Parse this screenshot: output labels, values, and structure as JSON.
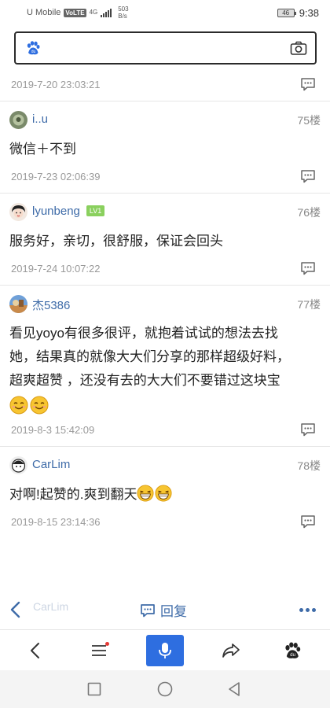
{
  "status_bar": {
    "carrier": "U Mobile",
    "volte": "VoLTE",
    "network": "4G",
    "speed_value": "503",
    "speed_unit": "B/s",
    "battery": "46",
    "time": "9:38"
  },
  "search": {
    "icons": [
      "baidu-paw-icon",
      "camera-icon"
    ]
  },
  "top_meta": {
    "timestamp": "2019-7-20 23:03:21"
  },
  "posts": [
    {
      "username": "i..u",
      "floor": "75楼",
      "content": "微信＋不到",
      "timestamp": "2019-7-23 02:06:39"
    },
    {
      "username": "lyunbeng",
      "level": "LV1",
      "floor": "76楼",
      "content": "服务好，亲切，很舒服，保证会回头",
      "timestamp": "2019-7-24 10:07:22"
    },
    {
      "username": "杰5386",
      "floor": "77楼",
      "content_lines": [
        "看见yoyo有很多很评，就抱着试试的想法去找",
        "她，结果真的就像大大们分享的那样超级好料，",
        "超爽超赞 ，还没有去的大大们不要错过这块宝"
      ],
      "timestamp": "2019-8-3 15:42:09"
    },
    {
      "username": "CarLim",
      "floor": "78楼",
      "content": "对啊!起赞的.爽到翻天",
      "timestamp": "2019-8-15 23:14:36"
    }
  ],
  "action_bar": {
    "ghost_username": "CarLim",
    "reply_label": "回复"
  },
  "colors": {
    "link_blue": "#3e6ba8",
    "accent_blue": "#2e6ee0",
    "level_green": "#8ad05e"
  }
}
